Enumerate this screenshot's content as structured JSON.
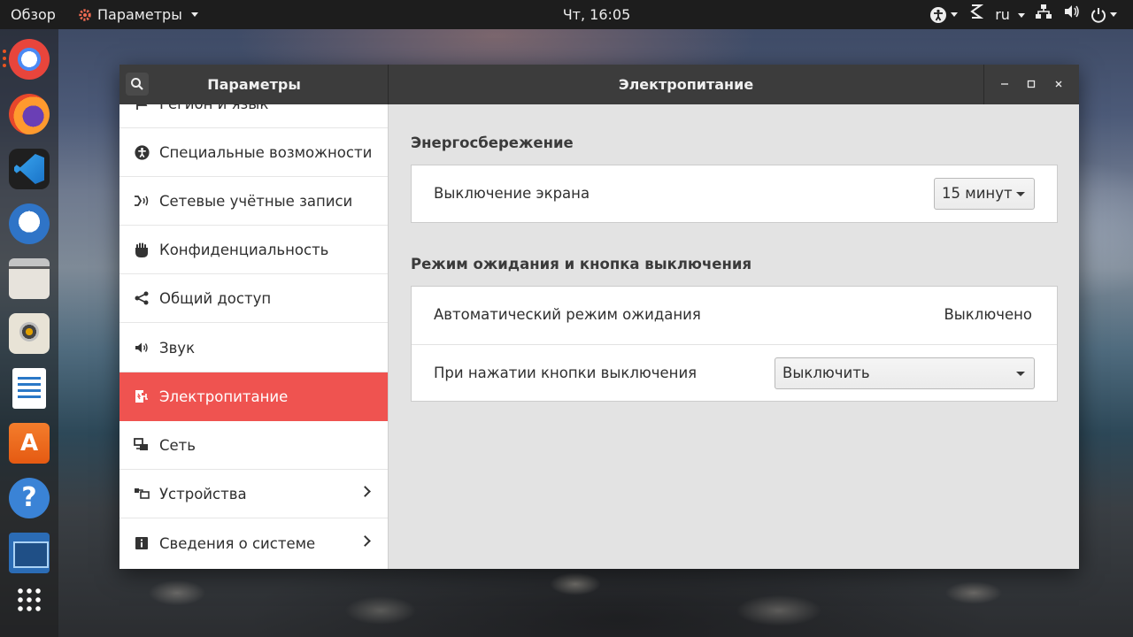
{
  "topbar": {
    "overview": "Обзор",
    "app_menu": "Параметры",
    "clock": "Чт, 16:05",
    "keyboard_layout": "ru"
  },
  "dock": {
    "apps": [
      "chrome-icon",
      "firefox-icon",
      "vscode-icon",
      "thunderbird-icon",
      "files-icon",
      "rhythmbox-icon",
      "libreoffice-writer-icon",
      "software-store-icon",
      "help-icon",
      "system-monitor-icon",
      "show-apps-icon"
    ]
  },
  "window": {
    "sidebar_title": "Параметры",
    "panel_title": "Электропитание",
    "controls": {
      "minimize": "–",
      "maximize": "□",
      "close": "×"
    }
  },
  "sidebar": {
    "items": [
      {
        "label": "Регион и язык",
        "icon": "flag-icon"
      },
      {
        "label": "Специальные возможности",
        "icon": "accessibility-icon"
      },
      {
        "label": "Сетевые учётные записи",
        "icon": "online-accounts-icon"
      },
      {
        "label": "Конфиденциальность",
        "icon": "hand-icon"
      },
      {
        "label": "Общий доступ",
        "icon": "share-icon"
      },
      {
        "label": "Звук",
        "icon": "speaker-icon"
      },
      {
        "label": "Электропитание",
        "icon": "power-plug-icon",
        "active": true
      },
      {
        "label": "Сеть",
        "icon": "network-icon"
      },
      {
        "label": "Устройства",
        "icon": "devices-icon",
        "has_submenu": true
      },
      {
        "label": "Сведения о системе",
        "icon": "info-icon",
        "has_submenu": true
      }
    ]
  },
  "power": {
    "saving": {
      "heading": "Энергосбережение",
      "blank_screen_label": "Выключение экрана",
      "blank_screen_value": "15 минут"
    },
    "suspend": {
      "heading": "Режим ожидания и кнопка выключения",
      "auto_suspend_label": "Автоматический режим ожидания",
      "auto_suspend_value": "Выключено",
      "power_button_label": "При нажатии кнопки выключения",
      "power_button_value": "Выключить"
    }
  },
  "colors": {
    "accent": "#ef5350",
    "topbar": "#1d1d1d",
    "headerbar": "#3c3c3c"
  }
}
